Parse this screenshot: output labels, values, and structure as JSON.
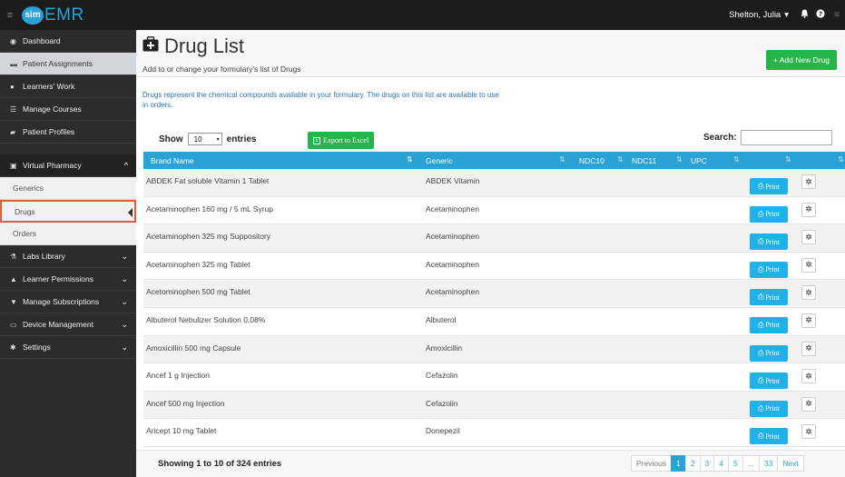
{
  "topbar": {
    "logo_badge": "sim",
    "logo_text": "EMR",
    "user_name": "Shelton, Julia",
    "user_caret": "▾",
    "bell_icon": "bell-icon",
    "help_icon": "question-icon"
  },
  "sidebar": {
    "items": [
      {
        "label": "Dashboard",
        "icon": "dashboard-icon"
      },
      {
        "label": "Patient Assignments",
        "icon": "bed-icon"
      },
      {
        "label": "Learners' Work",
        "icon": "users-icon"
      },
      {
        "label": "Manage Courses",
        "icon": "list-icon"
      },
      {
        "label": "Patient Profiles",
        "icon": "folder-icon"
      }
    ],
    "pharmacy": {
      "label": "Virtual Pharmacy",
      "icon": "medkit-icon",
      "chevron": "^"
    },
    "pharmacy_sub": [
      {
        "label": "Generics"
      },
      {
        "label": "Drugs"
      },
      {
        "label": "Orders"
      }
    ],
    "groups": [
      {
        "label": "Labs Library",
        "icon": "flask-icon"
      },
      {
        "label": "Learner Permissions",
        "icon": "lock-icon"
      },
      {
        "label": "Manage Subscriptions",
        "icon": "cart-icon"
      },
      {
        "label": "Device Management",
        "icon": "monitor-icon"
      },
      {
        "label": "Settings",
        "icon": "gear-icon"
      }
    ]
  },
  "header": {
    "title": "Drug List",
    "subtitle": "Add to or change your formulary's list of Drugs",
    "add_button": "+ Add New Drug"
  },
  "description": "Drugs represent the chemical compounds available in your formulary. The drugs on this list are available to use in orders.",
  "controls": {
    "show_label": "Show",
    "entries_value": "10",
    "entries_label": "entries",
    "export_label": "Export to Excel",
    "search_label": "Search:",
    "search_value": ""
  },
  "table": {
    "columns": [
      "Brand Name",
      "Generic",
      "NDC10",
      "NDC11",
      "UPC"
    ],
    "print_label": "Print",
    "rows": [
      {
        "brand": "ABDEK Fat soluble Vitamin 1 Tablet",
        "generic": "ABDEK Vitamin"
      },
      {
        "brand": "Acetaminophen 160 mg / 5 mL Syrup",
        "generic": "Acetaminophen"
      },
      {
        "brand": "Acetaminophen 325 mg Suppository",
        "generic": "Acetaminophen"
      },
      {
        "brand": "Acetaminophen 325 mg Tablet",
        "generic": "Acetaminophen"
      },
      {
        "brand": "Acetominophen 500 mg Tablet",
        "generic": "Acetaminophen"
      },
      {
        "brand": "Albuterol Nebulizer Solution 0.08%",
        "generic": "Albuterol"
      },
      {
        "brand": "Amoxicillin 500 mg Capsule",
        "generic": "Amoxicillin"
      },
      {
        "brand": "Ancef 1 g Injection",
        "generic": "Cefazolin"
      },
      {
        "brand": "Ancef 500 mg Injection",
        "generic": "Cefazolin"
      },
      {
        "brand": "Aricept 10 mg Tablet",
        "generic": "Donepezil"
      }
    ]
  },
  "footer": {
    "showing": "Showing 1 to 10 of 324 entries",
    "pager": [
      "Previous",
      "1",
      "2",
      "3",
      "4",
      "5",
      "...",
      "33",
      "Next"
    ],
    "active_page": "1"
  },
  "colors": {
    "accent": "#2aa2d6",
    "green": "#27b44b",
    "print": "#22b1e6",
    "highlight": "#e8583a"
  }
}
